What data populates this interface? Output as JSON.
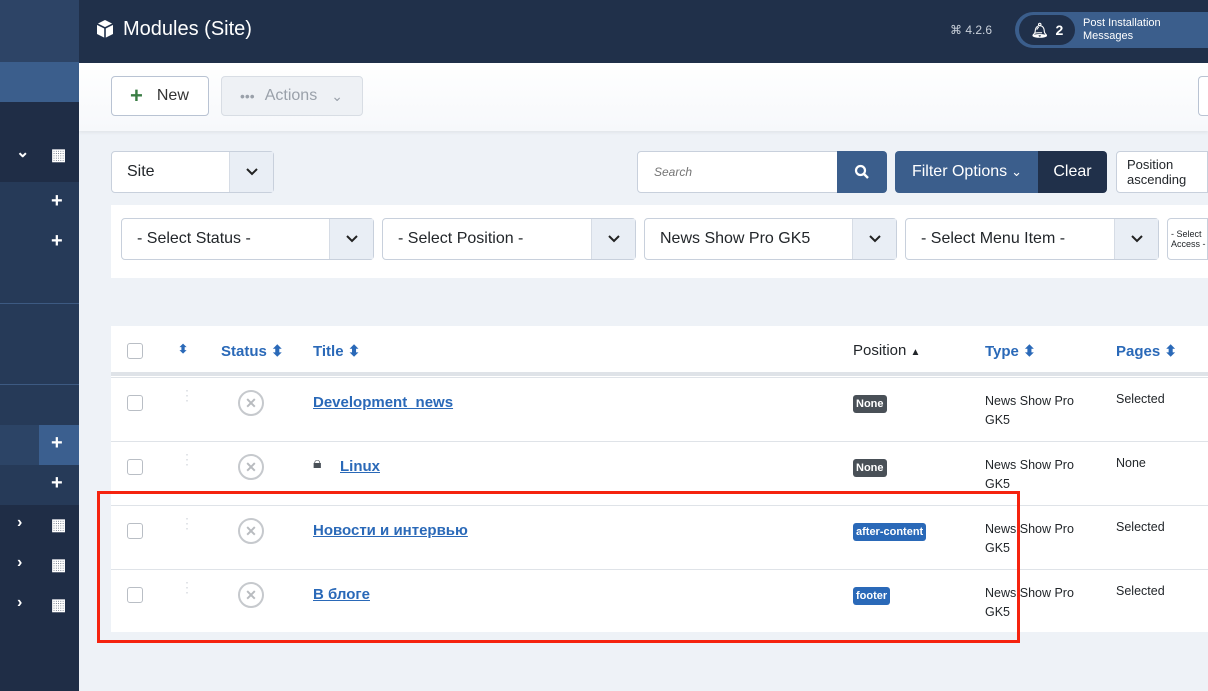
{
  "header": {
    "title": "Modules (Site)",
    "version": "4.2.6",
    "notif_count": "2",
    "notif_label": "Post Installation Messages"
  },
  "toolbar": {
    "new_label": "New",
    "actions_label": "Actions"
  },
  "filters": {
    "client": "Site",
    "search_placeholder": "Search",
    "filter_options": "Filter Options",
    "clear": "Clear",
    "ordering": "Position ascending",
    "status": "- Select Status -",
    "position": "- Select Position -",
    "module": "News Show Pro GK5",
    "menu_item": "- Select Menu Item -",
    "access": "- Select Access -"
  },
  "table": {
    "headers": {
      "status": "Status",
      "title": "Title",
      "position": "Position",
      "type": "Type",
      "pages": "Pages"
    },
    "rows": [
      {
        "title": "Development_news",
        "locked": false,
        "position": "None",
        "type": "News Show Pro GK5",
        "pages": "Selected"
      },
      {
        "title": "Linux",
        "locked": true,
        "position": "None",
        "type": "News Show Pro GK5",
        "pages": "None"
      },
      {
        "title": "Новости и интервью",
        "locked": false,
        "position": "after-content",
        "type": "News Show Pro GK5",
        "pages": "Selected"
      },
      {
        "title": "В блоге",
        "locked": false,
        "position": "footer",
        "type": "News Show Pro GK5",
        "pages": "Selected"
      }
    ]
  },
  "colors": {
    "accent": "#2a69b8",
    "header": "#20304a",
    "badge_none": "#495057",
    "highlight": "#f5230f"
  }
}
